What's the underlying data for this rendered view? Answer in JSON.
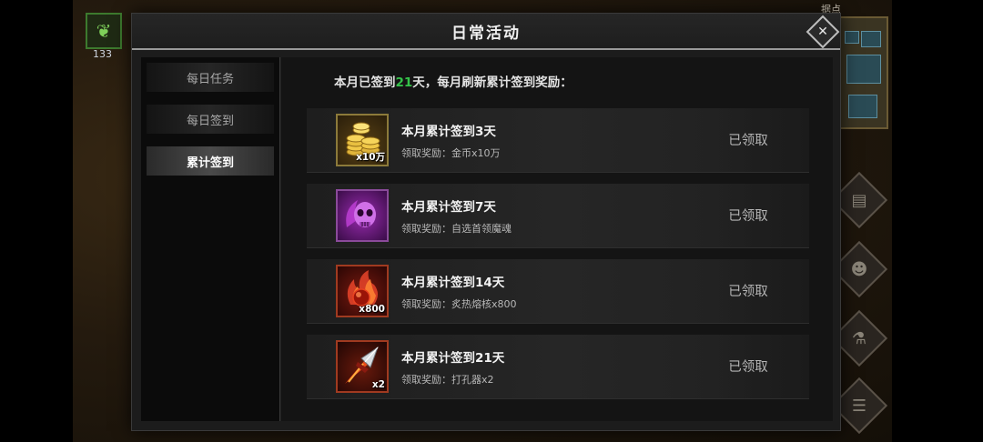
{
  "modal": {
    "title": "日常活动",
    "close_icon": "close-icon"
  },
  "sidebar": {
    "tabs": [
      {
        "label": "每日任务",
        "active": false
      },
      {
        "label": "每日签到",
        "active": false
      },
      {
        "label": "累计签到",
        "active": true
      }
    ]
  },
  "summary": {
    "prefix": "本月已签到",
    "days": "21",
    "suffix": "天，每月刷新累计签到奖励："
  },
  "rewards": [
    {
      "title": "本月累计签到3天",
      "reward": "领取奖励：金币x10万",
      "qty": "x10万",
      "status": "已领取",
      "icon": "gold-coins-icon"
    },
    {
      "title": "本月累计签到7天",
      "reward": "领取奖励：自选首领魔魂",
      "qty": "",
      "status": "已领取",
      "icon": "purple-skull-soul-icon"
    },
    {
      "title": "本月累计签到14天",
      "reward": "领取奖励：炙热熔核x800",
      "qty": "x800",
      "status": "已领取",
      "icon": "fire-core-icon"
    },
    {
      "title": "本月累计签到21天",
      "reward": "领取奖励：打孔器x2",
      "qty": "x2",
      "status": "已领取",
      "icon": "drill-spike-icon"
    }
  ],
  "hud": {
    "item_count": "133",
    "location_label": "据点"
  },
  "colors": {
    "accent_green": "#35c34a",
    "gold_border": "#8c7a3a"
  }
}
